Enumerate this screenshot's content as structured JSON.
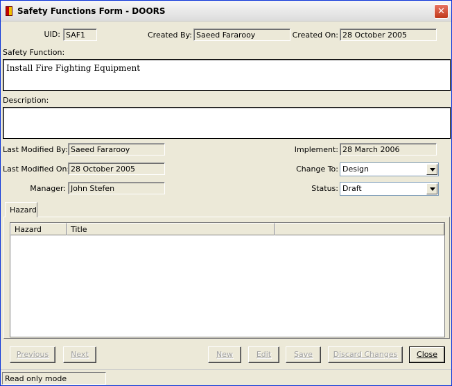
{
  "window": {
    "title": "Safety Functions Form - DOORS",
    "close_glyph": "✕"
  },
  "header": {
    "uid_label": "UID:",
    "uid_value": "SAF1",
    "created_by_label": "Created By:",
    "created_by_value": "Saeed Fararooy",
    "created_on_label": "Created On:",
    "created_on_value": "28 October 2005"
  },
  "safety_function": {
    "label": "Safety Function:",
    "value": "Install Fire Fighting Equipment"
  },
  "description": {
    "label": "Description:",
    "value": ""
  },
  "details": {
    "last_modified_by_label": "Last Modified By:",
    "last_modified_by_value": "Saeed Fararooy",
    "last_modified_on_label": "Last Modified On:",
    "last_modified_on_value": "28 October 2005",
    "manager_label": "Manager:",
    "manager_value": "John Stefen",
    "implement_label": "Implement:",
    "implement_value": "28 March 2006",
    "change_to_label": "Change To:",
    "change_to_value": "Design",
    "status_label": "Status:",
    "status_value": "Draft"
  },
  "tabs": [
    {
      "label": "Hazard"
    }
  ],
  "grid": {
    "columns": [
      "Hazard",
      "Title",
      ""
    ]
  },
  "buttons": {
    "previous": "Previous",
    "next": "Next",
    "new": "New",
    "edit": "Edit",
    "save": "Save",
    "discard": "Discard Changes",
    "close": "Close"
  },
  "status": {
    "text": "Read only mode"
  }
}
